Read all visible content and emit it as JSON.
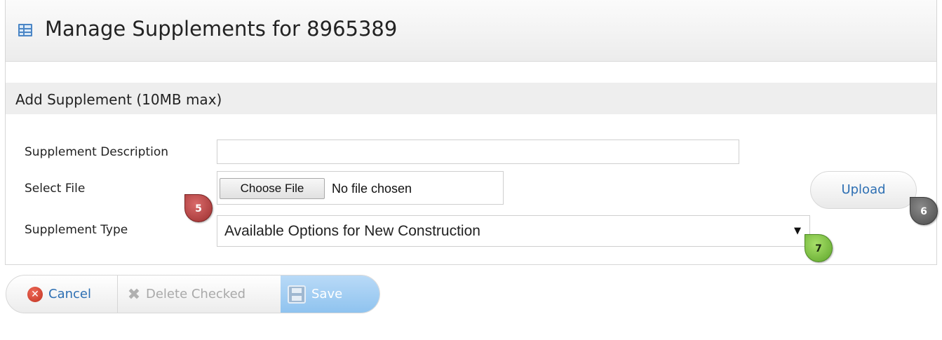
{
  "header": {
    "title": "Manage Supplements for 8965389",
    "icon": "table-icon"
  },
  "section": {
    "title": "Add Supplement (10MB max)"
  },
  "form": {
    "description_label": "Supplement Description",
    "description_value": "",
    "file_label": "Select File",
    "choose_file_label": "Choose File",
    "file_status": "No file chosen",
    "type_label": "Supplement Type",
    "type_selected": "Available Options for New Construction",
    "upload_label": "Upload"
  },
  "callouts": [
    "5",
    "6",
    "7"
  ],
  "toolbar": {
    "cancel_label": "Cancel",
    "delete_label": "Delete Checked",
    "save_label": "Save"
  },
  "colors": {
    "link": "#2d6fb3",
    "callout_5": "#9c2f2f",
    "callout_6": "#4a4a4a",
    "callout_7": "#5ea52a"
  }
}
